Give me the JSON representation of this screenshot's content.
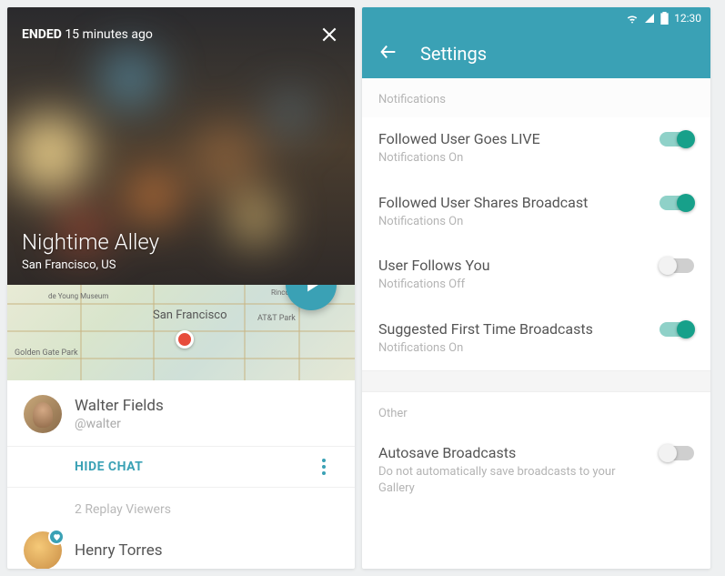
{
  "left": {
    "ended_label": "ENDED",
    "ended_time": "15 minutes ago",
    "stream_title": "Nightime Alley",
    "stream_location": "San Francisco, US",
    "map_city": "San Francisco",
    "map_label_1": "Golden Gate Park",
    "map_label_2": "AT&T Park",
    "map_label_3": "de Young Museum",
    "map_label_4": "Rincon",
    "user": {
      "name": "Walter Fields",
      "handle": "@walter"
    },
    "hide_chat": "HIDE CHAT",
    "replay_viewers": "2 Replay Viewers",
    "viewer1_name": "Henry Torres"
  },
  "right": {
    "statusbar_time": "12:30",
    "appbar_title": "Settings",
    "section_notifications": "Notifications",
    "section_other": "Other",
    "on_text": "Notifications On",
    "off_text": "Notifications Off",
    "items": {
      "0": {
        "title": "Followed User Goes LIVE",
        "sub": "Notifications On"
      },
      "1": {
        "title": "Followed User Shares Broadcast",
        "sub": "Notifications On"
      },
      "2": {
        "title": "User Follows You",
        "sub": "Notifications Off"
      },
      "3": {
        "title": "Suggested First Time Broadcasts",
        "sub": "Notifications On"
      }
    },
    "autosave": {
      "title": "Autosave Broadcasts",
      "sub": "Do not automatically save broadcasts to your Gallery"
    }
  }
}
